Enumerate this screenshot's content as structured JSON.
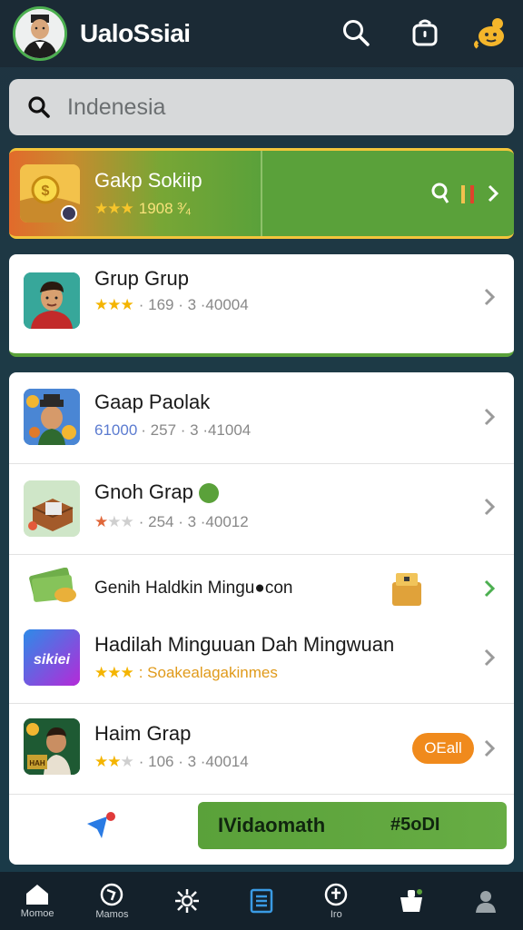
{
  "header": {
    "title": "UaloSsiai"
  },
  "search": {
    "placeholder": "Indenesia"
  },
  "featured": {
    "title": "Gakp Sokiip",
    "meta": "1908 ³⁄₄"
  },
  "card1": {
    "title": "Grup Grup",
    "meta": "· 169 · 3 ·40004"
  },
  "list": [
    {
      "title": "Gaap Paolak",
      "meta_prefix": "61000",
      "meta": "· 257 · 3 ·41004"
    },
    {
      "title": "Gnoh Grap",
      "meta": "· 254 · 3 ·40012"
    },
    {
      "title": "Genih Haldkin Mingu●con"
    },
    {
      "title": "Hadilah Minguuan Dah Mingwuan",
      "meta_gold": ": Soakealagakinmes"
    },
    {
      "title": "Haim Grap",
      "meta": "· 106 · 3 ·40014",
      "badge": "OEall"
    }
  ],
  "cta": {
    "label": "IVidaomath",
    "code": "#5oDI"
  },
  "nav": [
    {
      "label": "Momoe"
    },
    {
      "label": "Mamos"
    },
    {
      "label": ""
    },
    {
      "label": ""
    },
    {
      "label": "Iro"
    },
    {
      "label": ""
    },
    {
      "label": ""
    }
  ],
  "colors": {
    "accent": "#5aa13a",
    "header": "#1b2a35",
    "badge": "#f08a1c",
    "star": "#f4b400"
  }
}
